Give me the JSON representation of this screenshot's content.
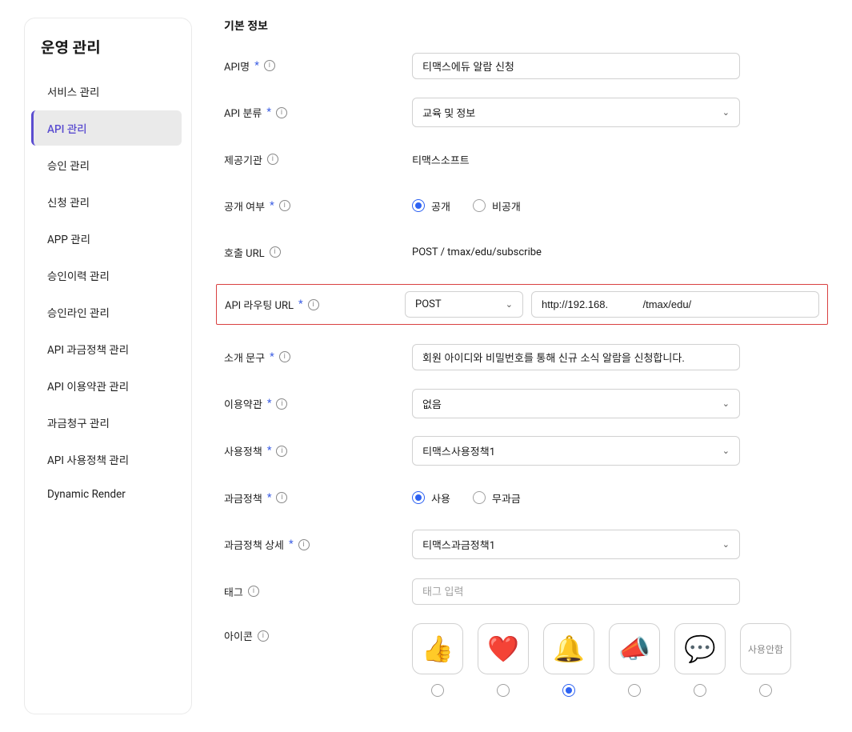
{
  "sidebar": {
    "title": "운영 관리",
    "items": [
      {
        "label": "서비스 관리"
      },
      {
        "label": "API 관리"
      },
      {
        "label": "승인 관리"
      },
      {
        "label": "신청 관리"
      },
      {
        "label": "APP 관리"
      },
      {
        "label": "승인이력 관리"
      },
      {
        "label": "승인라인 관리"
      },
      {
        "label": "API 과금정책 관리"
      },
      {
        "label": "API 이용약관 관리"
      },
      {
        "label": "과금청구 관리"
      },
      {
        "label": "API 사용정책 관리"
      },
      {
        "label": "Dynamic Render"
      }
    ]
  },
  "content": {
    "section_title": "기본 정보",
    "fields": {
      "api_name": {
        "label": "API명",
        "value": "티맥스에듀 알람 신청"
      },
      "api_category": {
        "label": "API 분류",
        "value": "교육 및 정보"
      },
      "provider": {
        "label": "제공기관",
        "value": "티맥스소프트"
      },
      "public": {
        "label": "공개 여부",
        "options": [
          "공개",
          "비공개"
        ],
        "selected": "공개"
      },
      "call_url": {
        "label": "호출 URL",
        "value": "POST / tmax/edu/subscribe"
      },
      "routing": {
        "label": "API 라우팅 URL",
        "method": "POST",
        "url": "http://192.168.            /tmax/edu/"
      },
      "intro": {
        "label": "소개 문구",
        "value": "회원 아이디와 비밀번호를 통해 신규 소식 알람을 신청합니다."
      },
      "terms": {
        "label": "이용약관",
        "value": "없음"
      },
      "usage_policy": {
        "label": "사용정책",
        "value": "티맥스사용정책1"
      },
      "billing": {
        "label": "과금정책",
        "options": [
          "사용",
          "무과금"
        ],
        "selected": "사용"
      },
      "billing_detail": {
        "label": "과금정책 상세",
        "value": "티맥스과금정책1"
      },
      "tag": {
        "label": "태그",
        "placeholder": "태그 입력"
      },
      "icon": {
        "label": "아이콘",
        "none_label": "사용안함"
      }
    }
  }
}
